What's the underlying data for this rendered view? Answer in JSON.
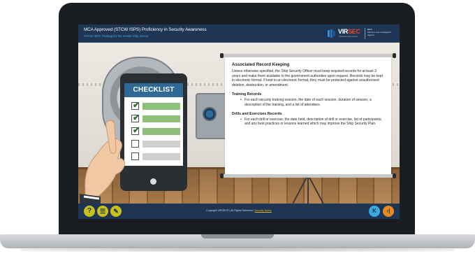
{
  "header": {
    "title": "MCA Approved (STCW ISPS) Proficiency in Security Awareness",
    "subtitle": "STCW ISPS Training for the Cruise Ship Sector"
  },
  "logo": {
    "brand_prefix": "VIR",
    "brand_suffix": "SEC",
    "tagline": "Virtual Security Training",
    "partner": "Maritime and Coastguard Agency",
    "partner_short": "MCA"
  },
  "tablet": {
    "checklist_title": "CHECKLIST",
    "items": [
      {
        "checked": true,
        "bar_color": "#8fc07a"
      },
      {
        "checked": true,
        "bar_color": "#8fc07a"
      },
      {
        "checked": true,
        "bar_color": "#8fc07a"
      },
      {
        "checked": false,
        "bar_color": "#cfcfcf"
      },
      {
        "checked": false,
        "bar_color": "#cfcfcf"
      }
    ]
  },
  "board": {
    "heading": "Associated Record Keeping",
    "intro": "Unless otherwise specified, the Ship Security Officer must keep required records for at least 3 years and make them available to the government authorities upon request. Records may be kept in electronic format. If kept in an electronic format, they must be protected against unauthorised deletion, destruction, or amendment.",
    "sections": [
      {
        "title": "Training Records",
        "bullets": [
          "For each security training session, the date of each session, duration of session, a description of the training, and a list of attendees."
        ]
      },
      {
        "title": "Drills and Exercises Records",
        "bullets": [
          "For each drill or exercise, the date held, description of drill or exercise, list of participants; and any best practices or lessons learned which may improve the Ship Security Plan."
        ]
      }
    ]
  },
  "footer": {
    "help_symbol": "?",
    "menu_symbol": "☰",
    "notes_symbol": "✎",
    "copyright": "Copyright VIRSEC® | All Rights Reserved |",
    "security_link": "Security Notice",
    "prev_symbol": "K",
    "next_symbol": "›|"
  },
  "colors": {
    "accent_yellow": "#c8c01c",
    "nav_prev": "#3aa9e0",
    "nav_next": "#e88a1e",
    "header_bg": "#1e3654"
  }
}
